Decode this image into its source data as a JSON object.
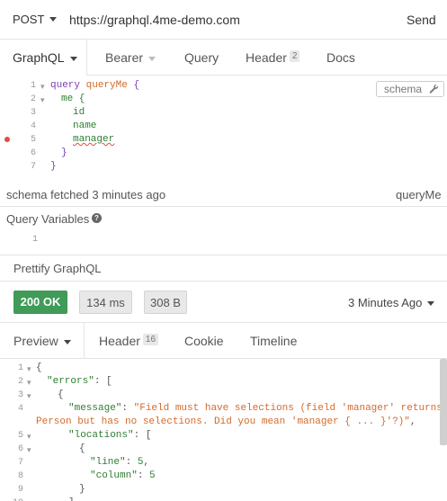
{
  "request": {
    "method": "POST",
    "url": "https://graphql.4me-demo.com",
    "send_label": "Send"
  },
  "request_tabs": [
    {
      "label": "GraphQL"
    },
    {
      "label": "Bearer"
    },
    {
      "label": "Query"
    },
    {
      "label": "Header",
      "badge": "2"
    },
    {
      "label": "Docs"
    }
  ],
  "editor": {
    "line_numbers": [
      "1",
      "2",
      "3",
      "4",
      "5",
      "6",
      "7"
    ],
    "lines": [
      {
        "parts": [
          "query",
          " ",
          "queryMe",
          " {"
        ]
      },
      {
        "text": "me {"
      },
      {
        "text": "id"
      },
      {
        "text": "name"
      },
      {
        "text": "manager"
      },
      {
        "text": "}"
      },
      {
        "text": "}"
      }
    ],
    "schema_button": "schema"
  },
  "status": {
    "fetched": "schema fetched 3 minutes ago",
    "operation": "queryMe"
  },
  "query_variables": {
    "title": "Query Variables",
    "line_number": "1"
  },
  "prettify_label": "Prettify GraphQL",
  "response": {
    "status": "200 OK",
    "time": "134 ms",
    "size": "308 B",
    "time_ago": "3 Minutes Ago"
  },
  "response_tabs": [
    {
      "label": "Preview"
    },
    {
      "label": "Header",
      "badge": "16"
    },
    {
      "label": "Cookie"
    },
    {
      "label": "Timeline"
    }
  ],
  "response_body": {
    "line_numbers": [
      "1",
      "2",
      "3",
      "4",
      "",
      "5",
      "6",
      "7",
      "8",
      "9",
      "10"
    ],
    "errors_key": "\"errors\"",
    "message_key": "\"message\"",
    "message_value_1": "\"Field must have selections (field 'manager' returns",
    "message_value_2": "Person but has no selections. Did you mean 'manager { ... }'?)\"",
    "locations_key": "\"locations\"",
    "line_key": "\"line\"",
    "line_value": "5",
    "column_key": "\"column\"",
    "column_value": "5"
  },
  "colors": {
    "status_ok": "#3f9b57",
    "error_dot": "#e04a4a",
    "keyword": "#7a3db8",
    "string": "#d36b2a",
    "field": "#2f7d32"
  }
}
